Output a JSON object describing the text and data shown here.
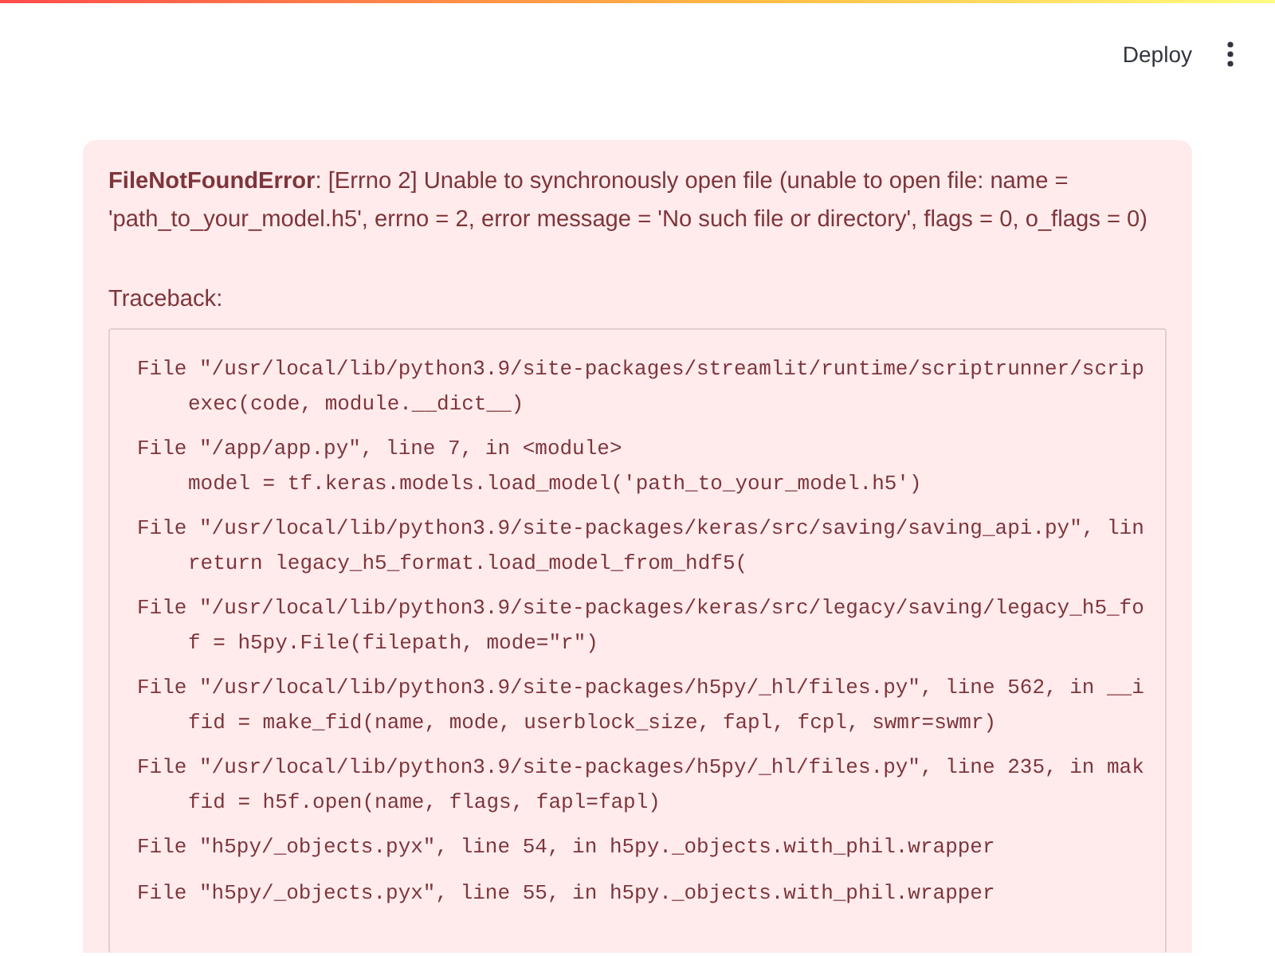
{
  "header": {
    "deploy_label": "Deploy"
  },
  "error": {
    "type": "FileNotFoundError",
    "message": ": [Errno 2] Unable to synchronously open file (unable to open file: name = 'path_to_your_model.h5', errno = 2, error message = 'No such file or directory', flags = 0, o_flags = 0)",
    "traceback_label": "Traceback:",
    "frames": [
      {
        "location": "File \"/usr/local/lib/python3.9/site-packages/streamlit/runtime/scriptrunner/scrip",
        "code": "exec(code, module.__dict__)"
      },
      {
        "location": "File \"/app/app.py\", line 7, in <module>",
        "code": "model = tf.keras.models.load_model('path_to_your_model.h5')"
      },
      {
        "location": "File \"/usr/local/lib/python3.9/site-packages/keras/src/saving/saving_api.py\", lin",
        "code": "return legacy_h5_format.load_model_from_hdf5("
      },
      {
        "location": "File \"/usr/local/lib/python3.9/site-packages/keras/src/legacy/saving/legacy_h5_fo",
        "code": "f = h5py.File(filepath, mode=\"r\")"
      },
      {
        "location": "File \"/usr/local/lib/python3.9/site-packages/h5py/_hl/files.py\", line 562, in __i",
        "code": "fid = make_fid(name, mode, userblock_size, fapl, fcpl, swmr=swmr)"
      },
      {
        "location": "File \"/usr/local/lib/python3.9/site-packages/h5py/_hl/files.py\", line 235, in mak",
        "code": "fid = h5f.open(name, flags, fapl=fapl)"
      },
      {
        "location": "File \"h5py/_objects.pyx\", line 54, in h5py._objects.with_phil.wrapper"
      },
      {
        "location": "File \"h5py/_objects.pyx\", line 55, in h5py._objects.with_phil.wrapper"
      }
    ]
  }
}
